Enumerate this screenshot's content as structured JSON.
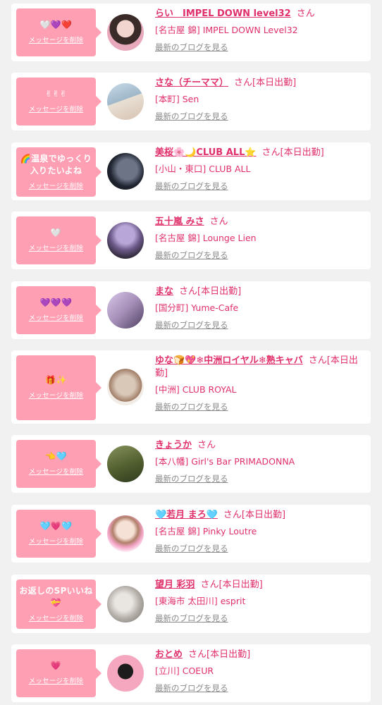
{
  "delete_label": "メッセージを削除",
  "blog_label": "最新のブログを見る",
  "entries": [
    {
      "message": "🤍💜❤️",
      "name": "らい　IMPEL DOWN level32",
      "suffix": "さん",
      "shop": "[名古屋 錦] IMPEL DOWN Level32"
    },
    {
      "message": "✌✌✌",
      "name": "さな（チーママ）",
      "suffix": "さん[本日出勤]",
      "shop": "[本町] Sen"
    },
    {
      "message": "🌈温泉でゆっくり入りたいよね",
      "name": "美桜🌸🌙CLUB ALL⭐",
      "suffix": "さん[本日出勤]",
      "shop": "[小山・東口] CLUB ALL"
    },
    {
      "message": "🤍",
      "name": "五十嵐 みさ",
      "suffix": "さん",
      "shop": "[名古屋 錦] Lounge Lien"
    },
    {
      "message": "💜💜💜",
      "name": "まな",
      "suffix": "さん[本日出勤]",
      "shop": "[国分町] Yume-Cafe"
    },
    {
      "message": "🎁✨",
      "name": "ゆな🍞💖❄中洲ロイヤル❄熟キャバ",
      "suffix": "さん[本日出勤]",
      "shop": "[中洲] CLUB ROYAL"
    },
    {
      "message": "👈🩵",
      "name": "きょうか",
      "suffix": "さん",
      "shop": "[本八幡] Girl's Bar PRIMADONNA"
    },
    {
      "message": "🩵💗🩵",
      "name": "🩵若月 まろ🩵",
      "suffix": "さん[本日出勤]",
      "shop": "[名古屋 錦] Pinky Loutre"
    },
    {
      "message": "お返しのSPいいね💝",
      "name": "望月 彩羽",
      "suffix": "さん[本日出勤]",
      "shop": "[東海市 太田川] esprit"
    },
    {
      "message": "💗",
      "name": "おとめ",
      "suffix": "さん[本日出勤]",
      "shop": "[立川] COEUR"
    }
  ]
}
